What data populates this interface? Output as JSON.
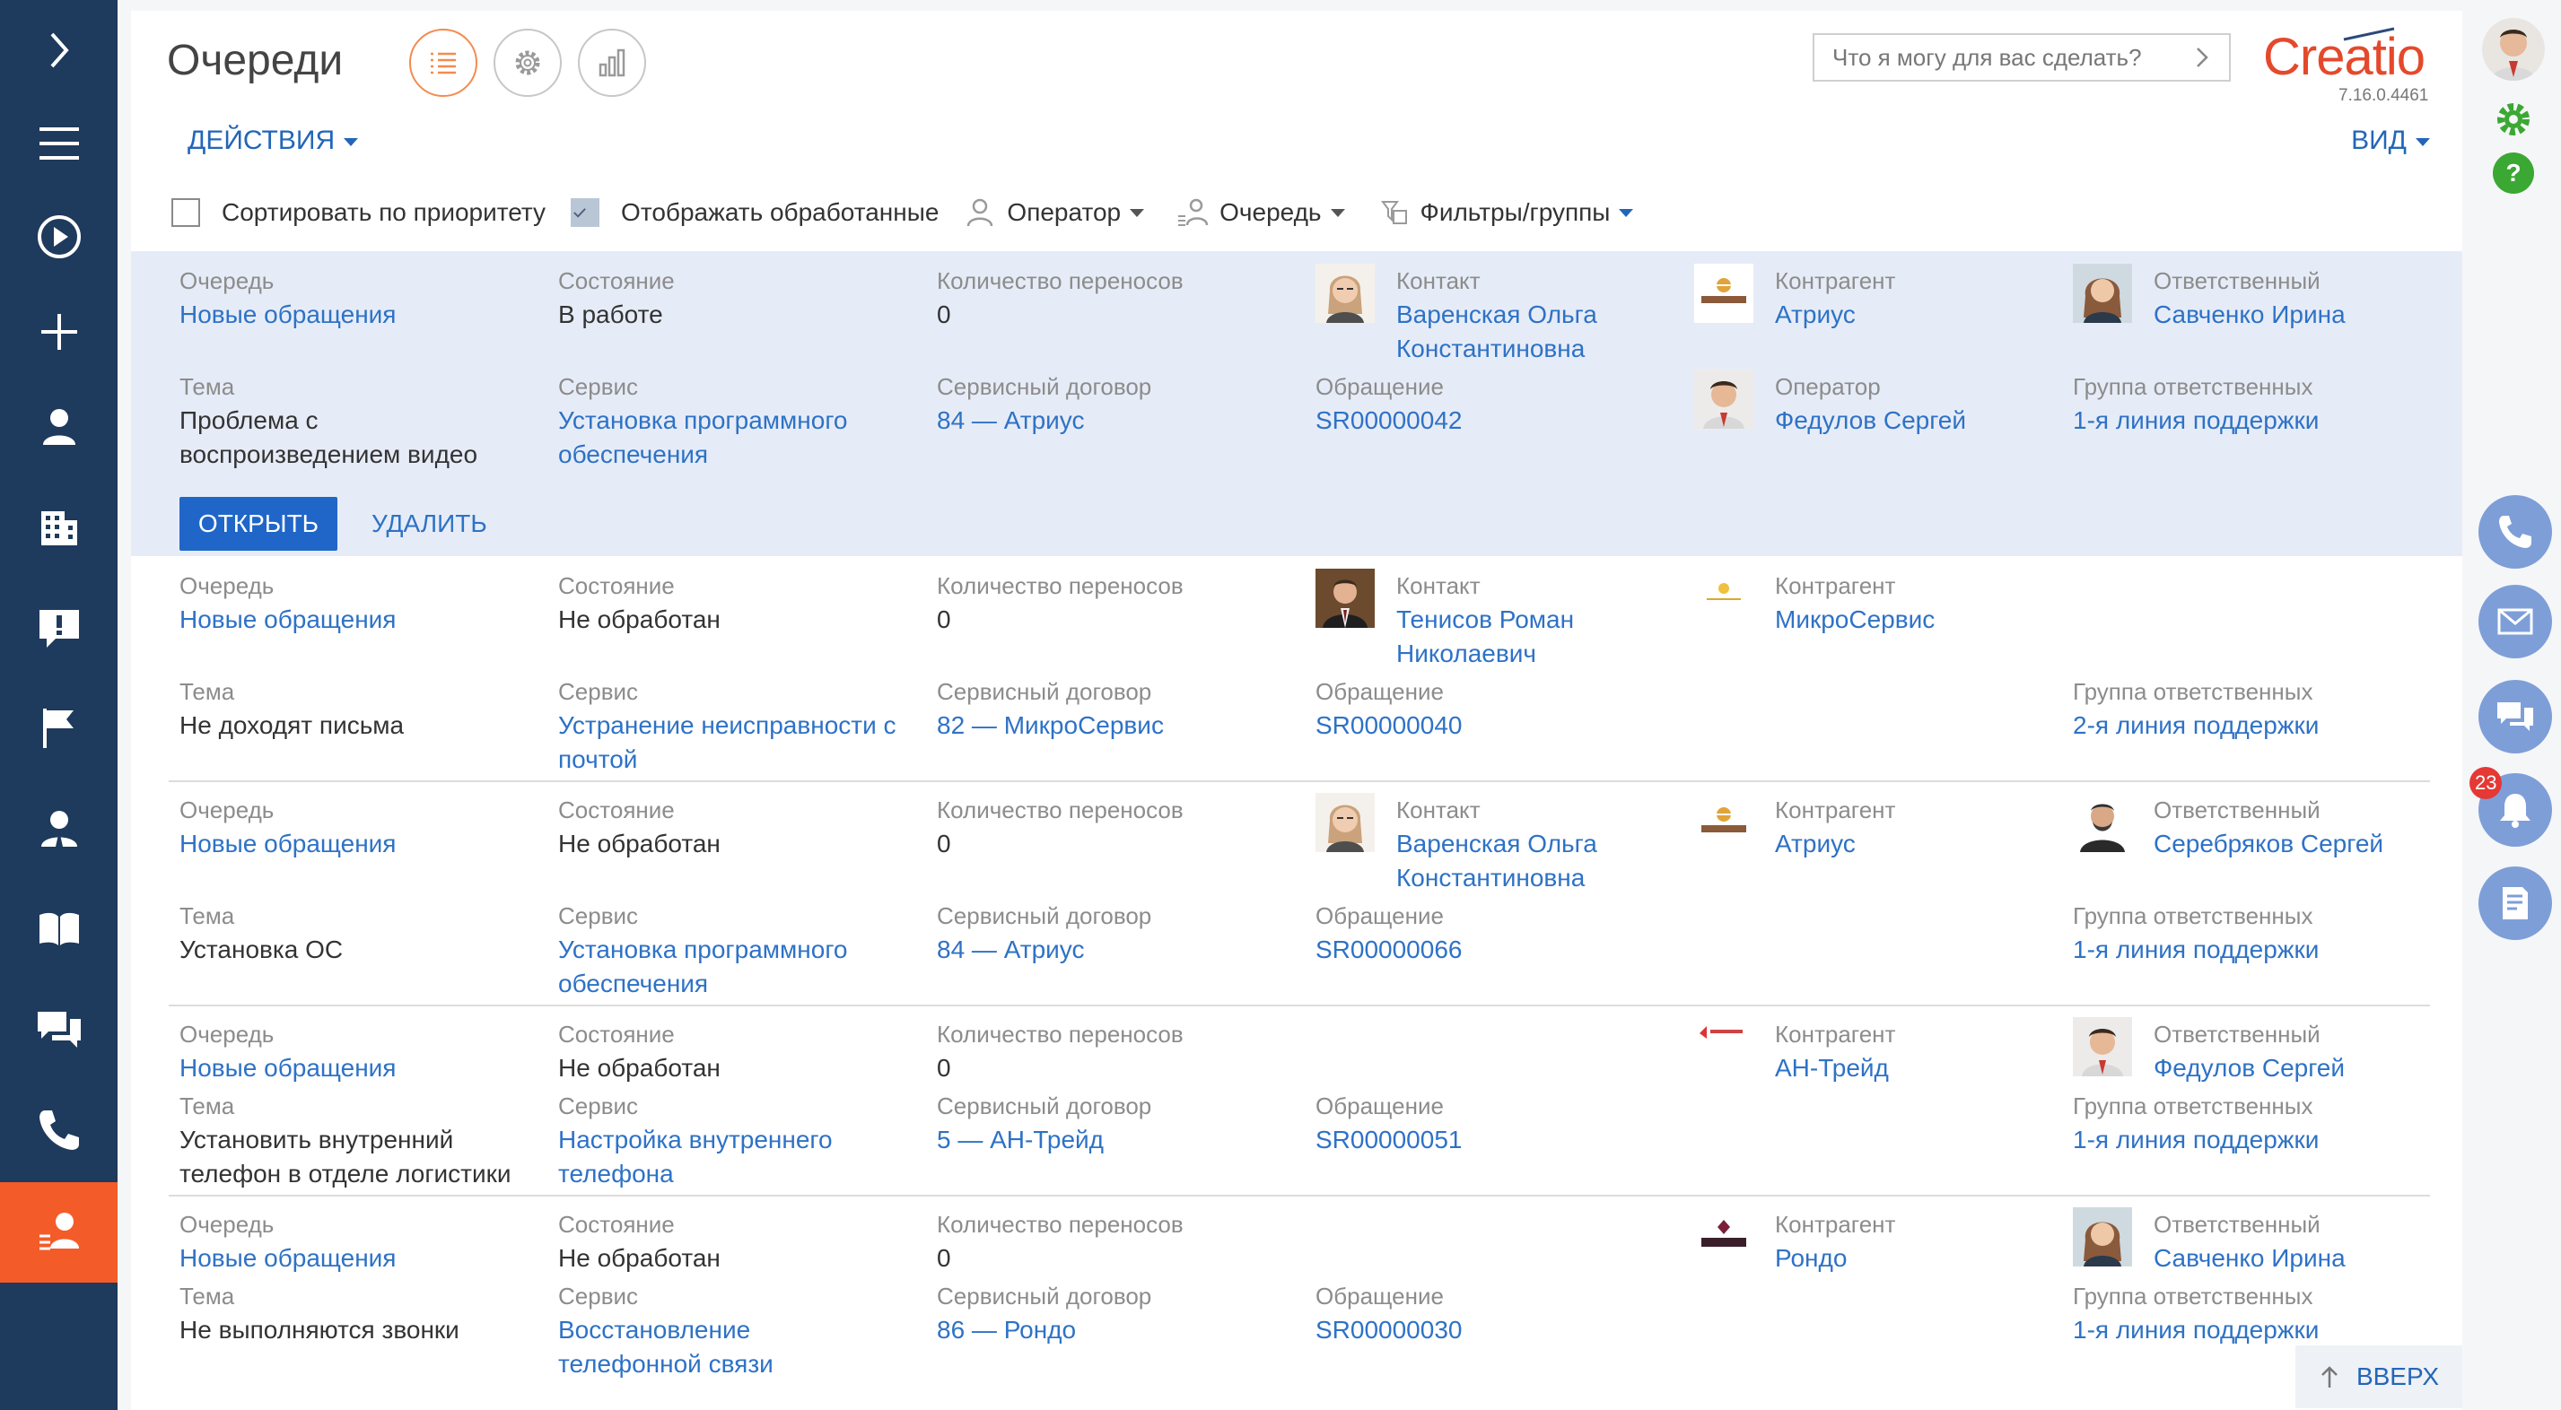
{
  "page": {
    "title": "Очереди",
    "search_placeholder": "Что я могу для вас сделать?",
    "logo": "Creatio",
    "version": "7.16.0.4461",
    "actions_label": "ДЕЙСТВИЯ",
    "view_label": "ВИД",
    "scroll_top_label": "ВВЕРХ"
  },
  "filters": {
    "sort_by_priority": "Сортировать по приоритету",
    "show_processed": "Отображать обработанные",
    "operator": "Оператор",
    "queue": "Очередь",
    "filters_groups": "Фильтры/группы"
  },
  "labels": {
    "queue": "Очередь",
    "state": "Состояние",
    "transfers": "Количество переносов",
    "contact": "Контакт",
    "account": "Контрагент",
    "owner": "Ответственный",
    "subject": "Тема",
    "service": "Сервис",
    "contract": "Сервисный договор",
    "case": "Обращение",
    "operator": "Оператор",
    "group": "Группа ответственных"
  },
  "row_buttons": {
    "open": "ОТКРЫТЬ",
    "delete": "УДАЛИТЬ"
  },
  "notifications": {
    "count": "23"
  },
  "rows": [
    {
      "queue": "Новые обращения",
      "state": "В работе",
      "transfers": "0",
      "contact": "Варенская Ольга Константиновна",
      "account": "Атриус",
      "owner": "Савченко Ирина",
      "subject": "Проблема с воспроизведением видео",
      "service": "Установка программного обеспечения",
      "contract": "84 — Атриус",
      "case": "SR00000042",
      "operator": "Федулов Сергей",
      "group": "1-я линия поддержки"
    },
    {
      "queue": "Новые обращения",
      "state": "Не обработан",
      "transfers": "0",
      "contact": "Тенисов Роман Николаевич",
      "account": "МикроСервис",
      "subject": "Не доходят письма",
      "service": "Устранение неисправности с почтой",
      "contract": "82 — МикроСервис",
      "case": "SR00000040",
      "group": "2-я линия поддержки"
    },
    {
      "queue": "Новые обращения",
      "state": "Не обработан",
      "transfers": "0",
      "contact": "Варенская Ольга Константиновна",
      "account": "Атриус",
      "owner": "Серебряков Сергей",
      "subject": "Установка ОС",
      "service": "Установка программного обеспечения",
      "contract": "84 — Атриус",
      "case": "SR00000066",
      "group": "1-я линия поддержки"
    },
    {
      "queue": "Новые обращения",
      "state": "Не обработан",
      "transfers": "0",
      "account": "АН-Трейд",
      "owner": "Федулов Сергей",
      "subject": "Установить внутренний телефон в отделе логистики",
      "service": "Настройка внутреннего телефона",
      "contract": "5 — АН-Трейд",
      "case": "SR00000051",
      "group": "1-я линия поддержки"
    },
    {
      "queue": "Новые обращения",
      "state": "Не обработан",
      "transfers": "0",
      "account": "Рондо",
      "owner": "Савченко Ирина",
      "subject": "Не выполняются звонки",
      "service": "Восстановление телефонной связи",
      "contract": "86 — Рондо",
      "case": "SR00000030",
      "group": "1-я линия поддержки"
    }
  ],
  "colors": {
    "nav_bg": "#1e3a5c",
    "accent": "#f35b29",
    "link": "#2e72c6",
    "selected_row": "#e6ecf7"
  }
}
